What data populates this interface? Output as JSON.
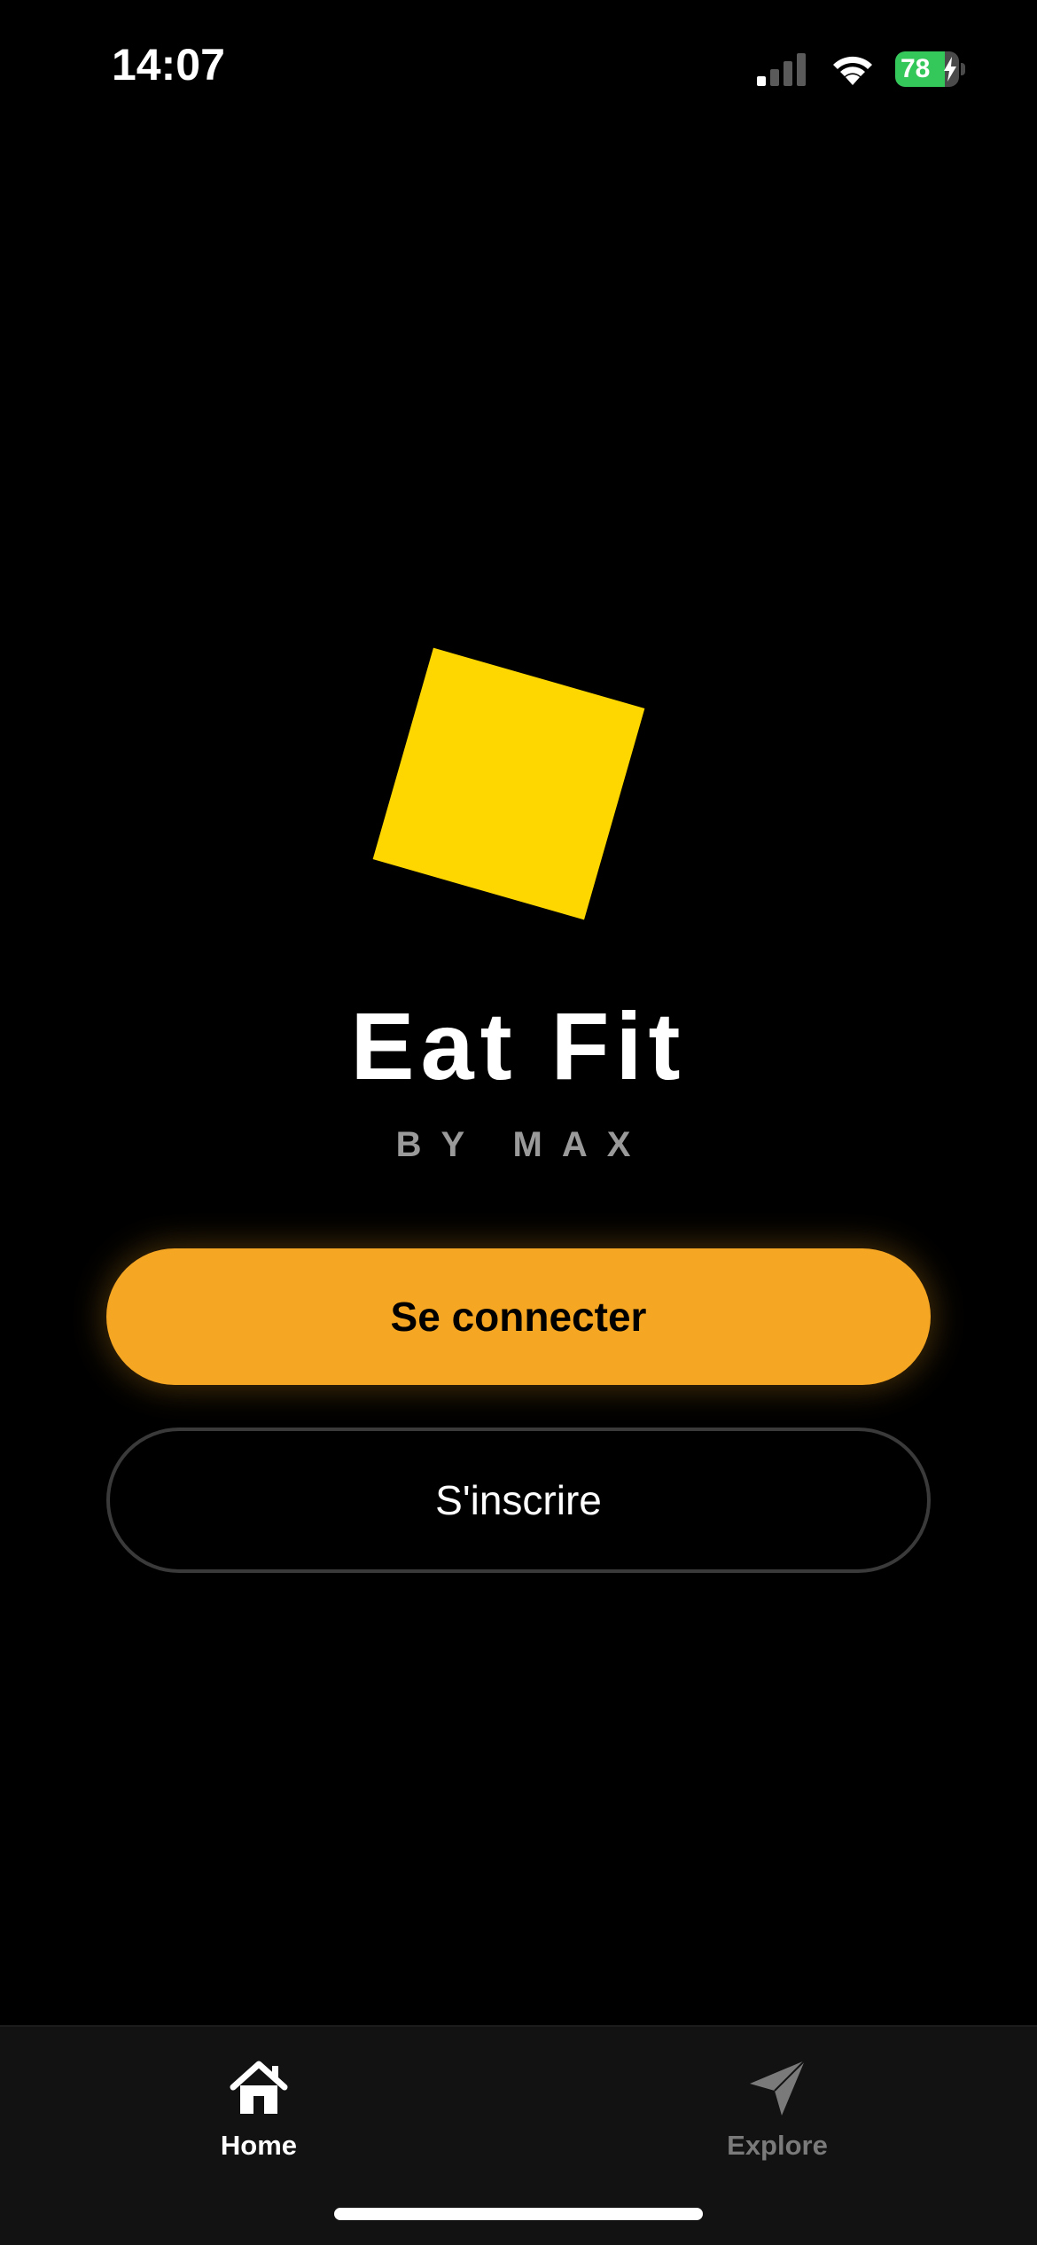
{
  "status_bar": {
    "time": "14:07",
    "battery_level": "78",
    "signal_bars_active": 1,
    "signal_bars_total": 4,
    "charging": true
  },
  "branding": {
    "title": "Eat Fit",
    "subtitle": "BY MAX",
    "logo_color": "#ffd700"
  },
  "actions": {
    "login_label": "Se connecter",
    "signup_label": "S'inscrire",
    "accent_color": "#f5a623"
  },
  "tab_bar": {
    "items": [
      {
        "label": "Home",
        "icon": "home-icon",
        "active": true
      },
      {
        "label": "Explore",
        "icon": "paper-plane-icon",
        "active": false
      }
    ]
  }
}
